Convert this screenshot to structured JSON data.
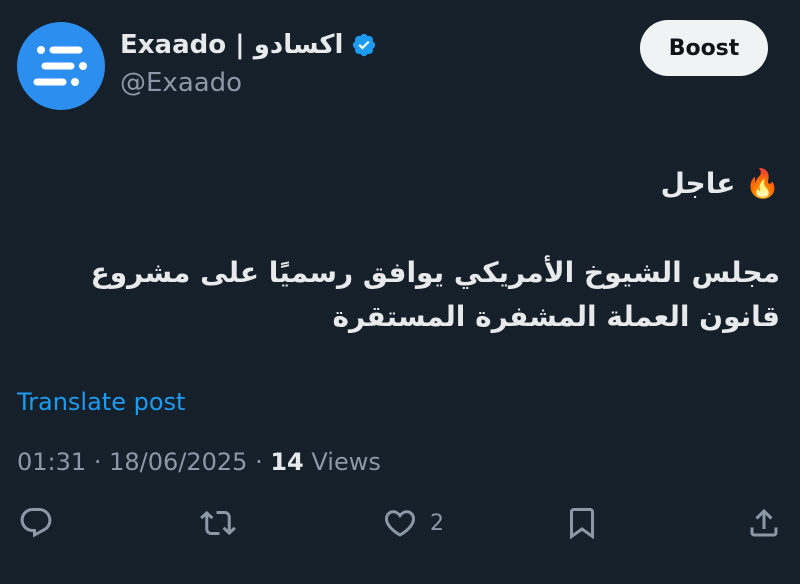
{
  "header": {
    "display_name": "Exaado | اكسادو",
    "handle": "@Exaado",
    "boost_label": "Boost"
  },
  "tweet": {
    "urgent_emoji": "🔥",
    "urgent_label": "عاجل",
    "body": "مجلس الشيوخ الأمريكي يوافق رسميًا على مشروع قانون العملة المشفرة المستقرة"
  },
  "translate_label": "Translate post",
  "meta": {
    "time": "01:31",
    "separator": "·",
    "date": "18/06/2025",
    "views_count": "14",
    "views_label": "Views"
  },
  "actions": {
    "reply_icon": "reply-icon",
    "retweet_icon": "retweet-icon",
    "like_icon": "heart-icon",
    "like_count": "2",
    "bookmark_icon": "bookmark-icon",
    "share_icon": "share-icon"
  },
  "colors": {
    "background": "#15202b",
    "accent": "#1d9bf0",
    "avatar": "#2c8ff0",
    "muted": "#8b98a5"
  }
}
